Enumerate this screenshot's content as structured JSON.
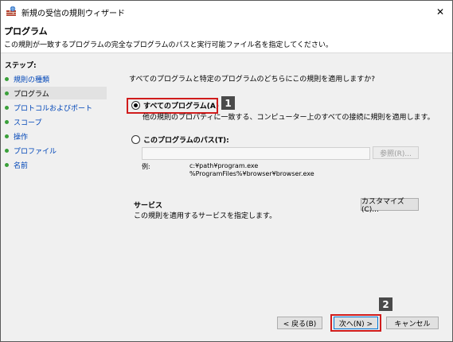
{
  "window": {
    "title": "新規の受信の規則ウィザード",
    "close_glyph": "✕"
  },
  "header": {
    "title": "プログラム",
    "description": "この規則が一致するプログラムの完全なプログラムのパスと実行可能ファイル名を指定してください。"
  },
  "sidebar": {
    "steps_label": "ステップ:",
    "items": [
      {
        "label": "規則の種類"
      },
      {
        "label": "プログラム"
      },
      {
        "label": "プロトコルおよびポート"
      },
      {
        "label": "スコープ"
      },
      {
        "label": "操作"
      },
      {
        "label": "プロファイル"
      },
      {
        "label": "名前"
      }
    ],
    "active_index": 1,
    "dot_color": "#3aa03a"
  },
  "main": {
    "question": "すべてのプログラムと特定のプログラムのどちらにこの規則を適用しますか?",
    "option_all": {
      "label": "すべてのプログラム(A)",
      "description": "他の規則のプロパティに一致する、コンピューター上のすべての接続に規則を適用します。",
      "checked": true
    },
    "option_path": {
      "label": "このプログラムのパス(T):",
      "value": "",
      "checked": false
    },
    "browse_button": "参照(R)...",
    "example_label": "例:",
    "example_lines": [
      "c:¥path¥program.exe",
      "%ProgramFiles%¥browser¥browser.exe"
    ],
    "services": {
      "title": "サービス",
      "description": "この規則を適用するサービスを指定します。",
      "customize_button": "カスタマイズ(C)..."
    }
  },
  "footer": {
    "back_button": "< 戻る(B)",
    "next_button": "次へ(N) >",
    "cancel_button": "キャンセル"
  },
  "annotations": {
    "badge1": "1",
    "badge2": "2",
    "highlight_color": "#d01c1c"
  }
}
